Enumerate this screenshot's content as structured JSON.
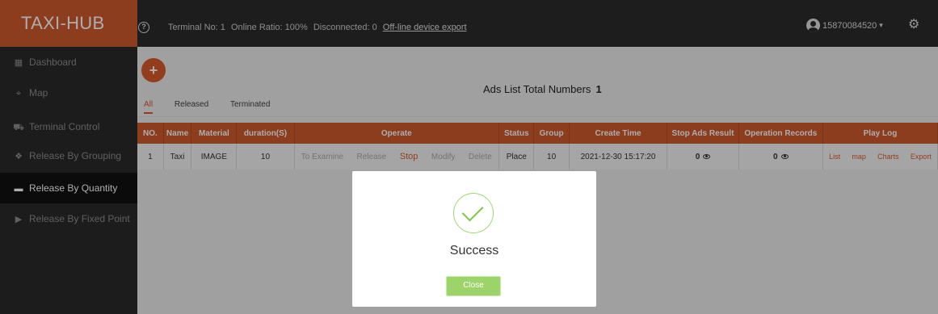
{
  "header": {
    "brand": "TAXI-HUB",
    "terminal_no": "Terminal No: 1",
    "online_ratio": "Online Ratio: 100%",
    "disconnected": "Disconnected: 0",
    "offline_export": "Off-line device export",
    "user_id": "15870084520"
  },
  "sidebar": {
    "items": [
      {
        "label": "Dashboard"
      },
      {
        "label": "Map"
      },
      {
        "label": "Terminal Control"
      },
      {
        "label": "Release By Grouping"
      },
      {
        "label": "Release By Quantity"
      },
      {
        "label": "Release By Fixed Point"
      }
    ]
  },
  "main": {
    "add_symbol": "+",
    "list_title": "Ads List Total Numbers",
    "total_count": "1",
    "tabs": [
      "All",
      "Released",
      "Terminated"
    ],
    "columns": [
      "NO.",
      "Name",
      "Material",
      "duration(S)",
      "Operate",
      "Status",
      "Group",
      "Create Time",
      "Stop Ads Result",
      "Operation Records",
      "Play Log"
    ],
    "row": {
      "no": "1",
      "name": "Taxi",
      "material": "IMAGE",
      "duration": "10",
      "operate": [
        "To Examine",
        "Release",
        "Stop",
        "Modify",
        "Delete"
      ],
      "status": "Place",
      "group": "10",
      "create_time": "2021-12-30 15:17:20",
      "stop_ads_result": "0",
      "operation_records": "0",
      "play_log": [
        "List",
        "map",
        "Charts",
        "Export"
      ]
    }
  },
  "modal": {
    "message": "Success",
    "close_label": "Close"
  },
  "colors": {
    "accent": "#cd5a2d",
    "success": "#9cd46a",
    "sidebar_bg": "#2a2a2a",
    "topbar_bg": "#2b2b2b"
  }
}
